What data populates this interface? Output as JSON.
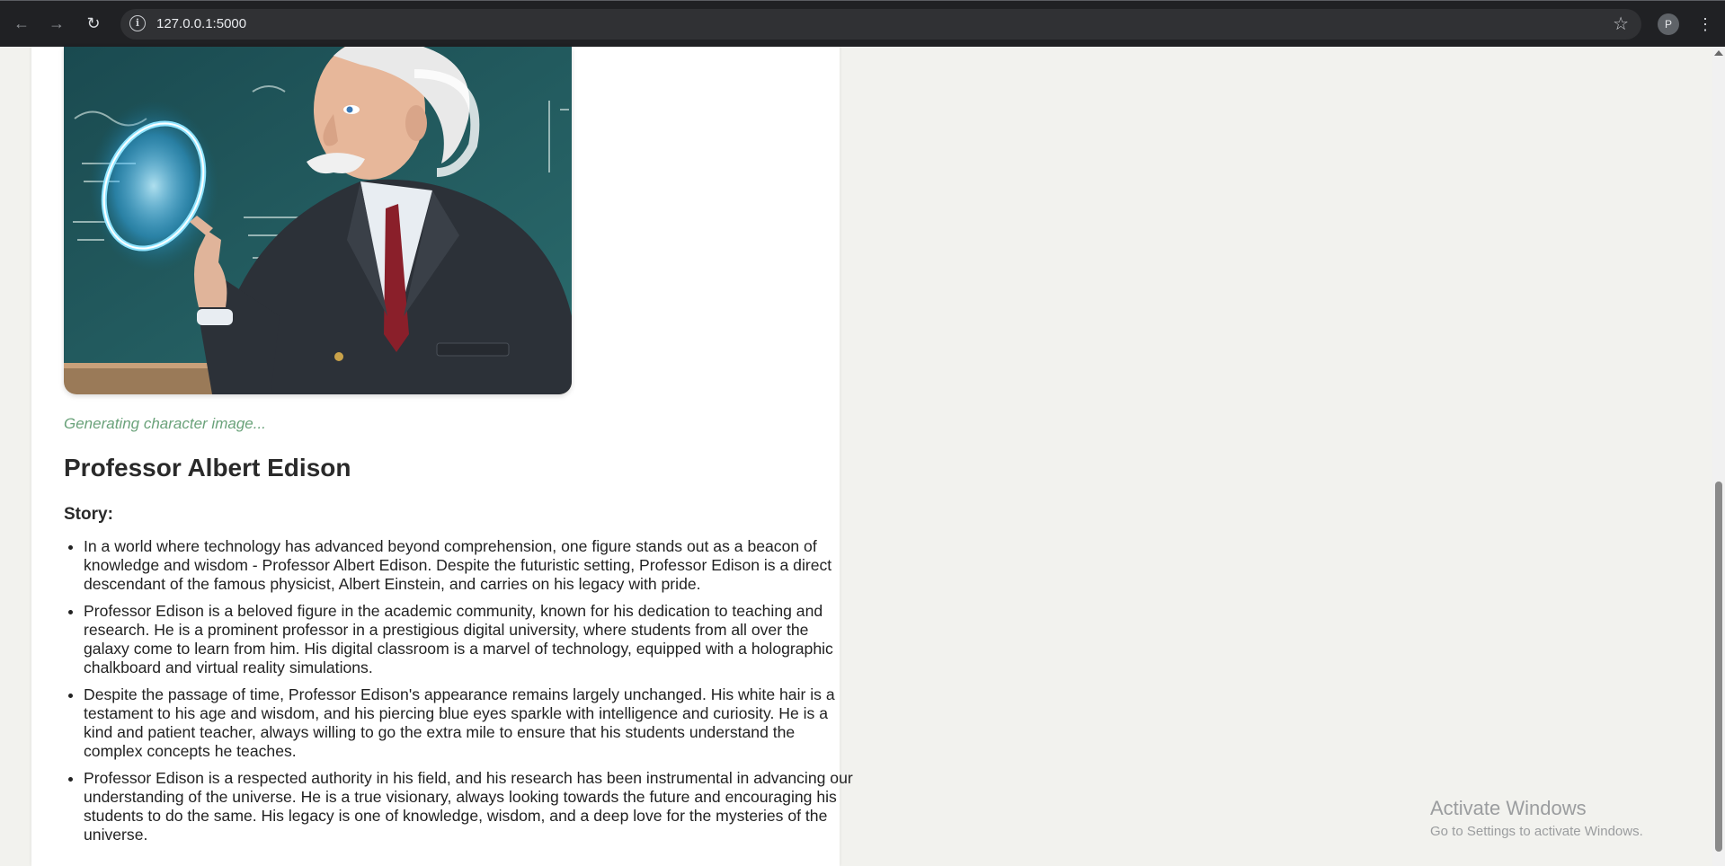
{
  "browser": {
    "url": "127.0.0.1:5000",
    "profile_initial": "P",
    "icons": {
      "back": "arrow-left-icon",
      "forward": "arrow-right-icon",
      "reload": "reload-icon",
      "site_info": "info-icon",
      "bookmark": "star-icon",
      "menu": "vertical-dots-icon"
    }
  },
  "character": {
    "image_alt": "Character portrait",
    "status": "Generating character image...",
    "name": "Professor Albert Edison",
    "story_label": "Story:",
    "story": [
      "In a world where technology has advanced beyond comprehension, one figure stands out as a beacon of knowledge and wisdom - Professor Albert Edison. Despite the futuristic setting, Professor Edison is a direct descendant of the famous physicist, Albert Einstein, and carries on his legacy with pride.",
      "Professor Edison is a beloved figure in the academic community, known for his dedication to teaching and research. He is a prominent professor in a prestigious digital university, where students from all over the galaxy come to learn from him. His digital classroom is a marvel of technology, equipped with a holographic chalkboard and virtual reality simulations.",
      "Despite the passage of time, Professor Edison's appearance remains largely unchanged. His white hair is a testament to his age and wisdom, and his piercing blue eyes sparkle with intelligence and curiosity. He is a kind and patient teacher, always willing to go the extra mile to ensure that his students understand the complex concepts he teaches.",
      "Professor Edison is a respected authority in his field, and his research has been instrumental in advancing our understanding of the universe. He is a true visionary, always looking towards the future and encouraging his students to do the same. His legacy is one of knowledge, wisdom, and a deep love for the mysteries of the universe."
    ]
  },
  "watermark": {
    "title": "Activate Windows",
    "subtitle": "Go to Settings to activate Windows."
  }
}
